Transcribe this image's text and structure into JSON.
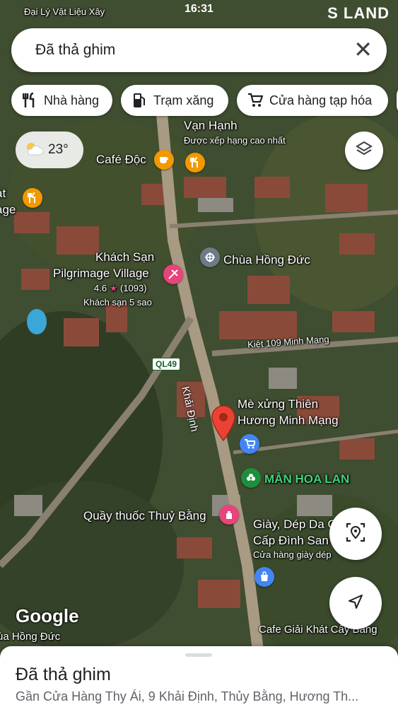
{
  "status_bar": {
    "time": "16:31",
    "carrier_text": "Đại Lý Vật Liệu Xây",
    "brand": "S LAND"
  },
  "search": {
    "query": "Đã thả ghim"
  },
  "chips": [
    {
      "label": "Nhà hàng",
      "icon": "fork-knife-icon"
    },
    {
      "label": "Trạm xăng",
      "icon": "gas-pump-icon"
    },
    {
      "label": "Cửa hàng tạp hóa",
      "icon": "cart-icon"
    }
  ],
  "weather": {
    "temp": "23°",
    "icon": "partly-cloudy-icon"
  },
  "map": {
    "attribution": "Google",
    "pin_color": "#ea4335",
    "places": {
      "van_hanh_line1": "Vạn Hạnh",
      "van_hanh_line2": "Được xếp hạng cao nhất",
      "cafe_doc": "Café Độc",
      "left_edge_1": "at",
      "left_edge_2": "age",
      "hotel_name_1": "Khách Sạn",
      "hotel_name_2": "Pilgrimage Village",
      "hotel_rating": "4.6",
      "hotel_reviews": "(1093)",
      "hotel_type": "Khách sạn 5 sao",
      "pagoda": "Chùa Hồng Đức",
      "kiet": "Kiệt 109 Minh Mạng",
      "road": "Khải Định",
      "road_shield": "QL49",
      "me_xung_1": "Mè xửng Thiên",
      "me_xung_2": "Hương Minh Mạng",
      "man_hoa_lan": "MẪN HOA LAN",
      "quay_thuoc": "Quầy thuốc Thuỷ Bằng",
      "giay_1": "Giày, Dép Da C",
      "giay_2": "Cấp Đình San",
      "giay_3": "Cửa hàng giày dép",
      "cafe_giai_khat": "Cafe Giải Khát Cây Bàng",
      "bottom_left": "ùa Hồng Đức"
    }
  },
  "sheet": {
    "title": "Đã thả ghim",
    "address": "Gần Cửa Hàng Thy Ái, 9 Khải Định, Thủy Bằng, Hương Th..."
  }
}
